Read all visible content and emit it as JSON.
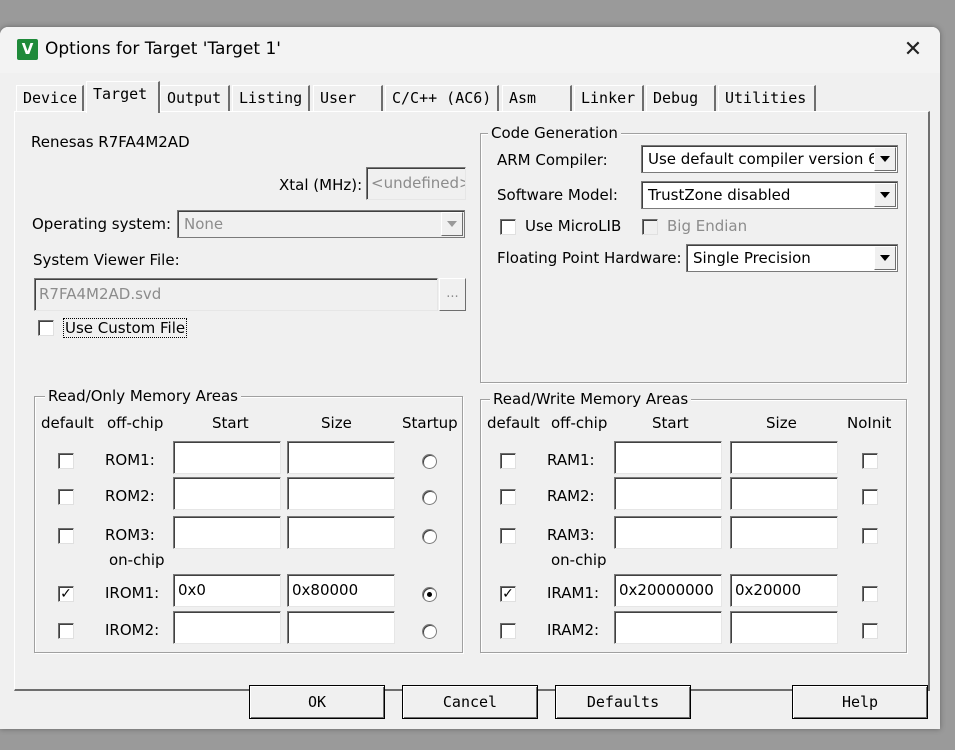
{
  "window": {
    "title": "Options for Target 'Target 1'",
    "app_icon_glyph": "V",
    "close_glyph": "✕"
  },
  "tabs": [
    "Device",
    "Target",
    "Output",
    "Listing",
    "User",
    "C/C++ (AC6)",
    "Asm",
    "Linker",
    "Debug",
    "Utilities"
  ],
  "active_tab": "Target",
  "device_name": "Renesas R7FA4M2AD",
  "xtal": {
    "label": "Xtal (MHz):",
    "value": "<undefined>"
  },
  "os": {
    "label": "Operating system:",
    "value": "None"
  },
  "svd": {
    "label": "System Viewer File:",
    "value": "R7FA4M2AD.svd",
    "browse": "...",
    "custom_label": "Use Custom File",
    "custom_checked": false
  },
  "codegen": {
    "title": "Code Generation",
    "compiler_label": "ARM Compiler:",
    "compiler_value": "Use default compiler version 6",
    "model_label": "Software Model:",
    "model_value": "TrustZone disabled",
    "microlib_label": "Use MicroLIB",
    "microlib_checked": false,
    "endian_label": "Big Endian",
    "endian_checked": false,
    "fpu_label": "Floating Point Hardware:",
    "fpu_value": "Single Precision"
  },
  "rom": {
    "title": "Read/Only Memory Areas",
    "headers": {
      "default": "default",
      "offchip": "off-chip",
      "start": "Start",
      "size": "Size",
      "extra": "Startup"
    },
    "onchip_label": "on-chip",
    "rows": [
      {
        "name": "ROM1:",
        "start": "",
        "size": "",
        "default": false,
        "startup": "enabled"
      },
      {
        "name": "ROM2:",
        "start": "",
        "size": "",
        "default": false,
        "startup": "enabled"
      },
      {
        "name": "ROM3:",
        "start": "",
        "size": "",
        "default": false,
        "startup": "enabled"
      },
      {
        "name": "IROM1:",
        "start": "0x0",
        "size": "0x80000",
        "default": true,
        "startup": "selected"
      },
      {
        "name": "IROM2:",
        "start": "",
        "size": "",
        "default": false,
        "startup": "enabled"
      }
    ]
  },
  "ram": {
    "title": "Read/Write Memory Areas",
    "headers": {
      "default": "default",
      "offchip": "off-chip",
      "start": "Start",
      "size": "Size",
      "extra": "NoInit"
    },
    "onchip_label": "on-chip",
    "rows": [
      {
        "name": "RAM1:",
        "start": "",
        "size": "",
        "default": false,
        "noinit": false
      },
      {
        "name": "RAM2:",
        "start": "",
        "size": "",
        "default": false,
        "noinit": false
      },
      {
        "name": "RAM3:",
        "start": "",
        "size": "",
        "default": false,
        "noinit": false
      },
      {
        "name": "IRAM1:",
        "start": "0x20000000",
        "size": "0x20000",
        "default": true,
        "noinit": false
      },
      {
        "name": "IRAM2:",
        "start": "",
        "size": "",
        "default": false,
        "noinit": false
      }
    ]
  },
  "buttons": {
    "ok": "OK",
    "cancel": "Cancel",
    "defaults": "Defaults",
    "help": "Help"
  },
  "colors": {
    "app_icon": "#1f8a3a",
    "dialog_bg": "#f0f0f0",
    "backdrop": "#9a9a9a"
  }
}
